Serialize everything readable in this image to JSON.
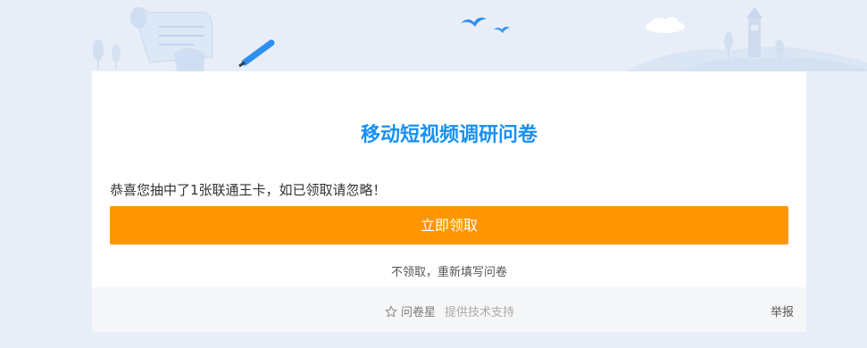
{
  "survey": {
    "title": "移动短视频调研问卷"
  },
  "result": {
    "message": "恭喜您抽中了1张联通王卡，如已领取请忽略！",
    "claim_label": "立即领取",
    "refill_label": "不领取，重新填写问卷"
  },
  "footer": {
    "brand_name": "问卷星",
    "support_text": "提供技术支持",
    "report_label": "举报"
  },
  "colors": {
    "accent_blue": "#1890f3",
    "claim_orange": "#ff9500"
  },
  "icons": {
    "brand": "star-outline-icon",
    "illustration": "header-scenery-illustration"
  }
}
